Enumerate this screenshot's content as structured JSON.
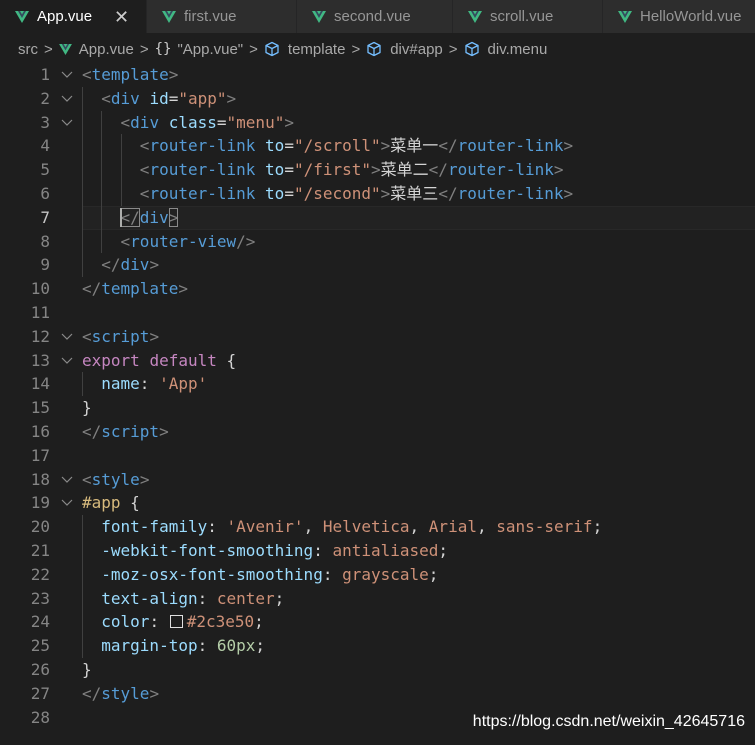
{
  "tabs": [
    {
      "label": "App.vue",
      "active": true,
      "close_glyph": "✕"
    },
    {
      "label": "first.vue",
      "active": false
    },
    {
      "label": "second.vue",
      "active": false
    },
    {
      "label": "scroll.vue",
      "active": false
    },
    {
      "label": "HelloWorld.vue",
      "active": false
    }
  ],
  "breadcrumb": {
    "items": [
      {
        "label": "src",
        "icon": null
      },
      {
        "label": "App.vue",
        "icon": "vue-icon"
      },
      {
        "label": "\"App.vue\"",
        "icon": "braces-icon"
      },
      {
        "label": "template",
        "icon": "cube-icon"
      },
      {
        "label": "div#app",
        "icon": "cube-icon"
      },
      {
        "label": "div.menu",
        "icon": "cube-icon"
      }
    ],
    "separator": ">",
    "braces_glyph": "{}"
  },
  "editor": {
    "current_line": 7,
    "lines": [
      {
        "n": "1",
        "tokens": [
          [
            "punc",
            "<"
          ],
          [
            "tag",
            "template"
          ],
          [
            "punc",
            ">"
          ]
        ]
      },
      {
        "n": "2",
        "tokens": [
          [
            "ws",
            "  "
          ],
          [
            "punc",
            "<"
          ],
          [
            "tag",
            "div"
          ],
          [
            "ws",
            " "
          ],
          [
            "attr",
            "id"
          ],
          [
            "plain",
            "="
          ],
          [
            "str",
            "\"app\""
          ],
          [
            "punc",
            ">"
          ]
        ]
      },
      {
        "n": "3",
        "tokens": [
          [
            "ws",
            "    "
          ],
          [
            "punc",
            "<"
          ],
          [
            "tag",
            "div"
          ],
          [
            "ws",
            " "
          ],
          [
            "attr",
            "class"
          ],
          [
            "plain",
            "="
          ],
          [
            "str",
            "\"menu\""
          ],
          [
            "punc",
            ">"
          ]
        ]
      },
      {
        "n": "4",
        "tokens": [
          [
            "ws",
            "      "
          ],
          [
            "punc",
            "<"
          ],
          [
            "tag",
            "router-link"
          ],
          [
            "ws",
            " "
          ],
          [
            "attr",
            "to"
          ],
          [
            "plain",
            "="
          ],
          [
            "str",
            "\"/scroll\""
          ],
          [
            "punc",
            ">"
          ],
          [
            "plain",
            "菜单一"
          ],
          [
            "punc",
            "</"
          ],
          [
            "tag",
            "router-link"
          ],
          [
            "punc",
            ">"
          ]
        ]
      },
      {
        "n": "5",
        "tokens": [
          [
            "ws",
            "      "
          ],
          [
            "punc",
            "<"
          ],
          [
            "tag",
            "router-link"
          ],
          [
            "ws",
            " "
          ],
          [
            "attr",
            "to"
          ],
          [
            "plain",
            "="
          ],
          [
            "str",
            "\"/first\""
          ],
          [
            "punc",
            ">"
          ],
          [
            "plain",
            "菜单二"
          ],
          [
            "punc",
            "</"
          ],
          [
            "tag",
            "router-link"
          ],
          [
            "punc",
            ">"
          ]
        ]
      },
      {
        "n": "6",
        "tokens": [
          [
            "ws",
            "      "
          ],
          [
            "punc",
            "<"
          ],
          [
            "tag",
            "router-link"
          ],
          [
            "ws",
            " "
          ],
          [
            "attr",
            "to"
          ],
          [
            "plain",
            "="
          ],
          [
            "str",
            "\"/second\""
          ],
          [
            "punc",
            ">"
          ],
          [
            "plain",
            "菜单三"
          ],
          [
            "punc",
            "</"
          ],
          [
            "tag",
            "router-link"
          ],
          [
            "punc",
            ">"
          ]
        ]
      },
      {
        "n": "7",
        "tokens": [
          [
            "ws",
            "    "
          ],
          [
            "box",
            "</"
          ],
          [
            "tag",
            "div"
          ],
          [
            "box",
            ">"
          ]
        ]
      },
      {
        "n": "8",
        "tokens": [
          [
            "ws",
            "    "
          ],
          [
            "punc",
            "<"
          ],
          [
            "tag",
            "router-view"
          ],
          [
            "punc",
            "/>"
          ]
        ]
      },
      {
        "n": "9",
        "tokens": [
          [
            "ws",
            "  "
          ],
          [
            "punc",
            "</"
          ],
          [
            "tag",
            "div"
          ],
          [
            "punc",
            ">"
          ]
        ]
      },
      {
        "n": "10",
        "tokens": [
          [
            "punc",
            "</"
          ],
          [
            "tag",
            "template"
          ],
          [
            "punc",
            ">"
          ]
        ]
      },
      {
        "n": "11",
        "tokens": []
      },
      {
        "n": "12",
        "tokens": [
          [
            "punc",
            "<"
          ],
          [
            "tag",
            "script"
          ],
          [
            "punc",
            ">"
          ]
        ]
      },
      {
        "n": "13",
        "tokens": [
          [
            "kw",
            "export"
          ],
          [
            "ws",
            " "
          ],
          [
            "kw",
            "default"
          ],
          [
            "ws",
            " "
          ],
          [
            "plain",
            "{"
          ]
        ]
      },
      {
        "n": "14",
        "tokens": [
          [
            "ws",
            "  "
          ],
          [
            "attr",
            "name"
          ],
          [
            "plain",
            ": "
          ],
          [
            "str",
            "'App'"
          ]
        ]
      },
      {
        "n": "15",
        "tokens": [
          [
            "plain",
            "}"
          ]
        ]
      },
      {
        "n": "16",
        "tokens": [
          [
            "punc",
            "</"
          ],
          [
            "tag",
            "script"
          ],
          [
            "punc",
            ">"
          ]
        ]
      },
      {
        "n": "17",
        "tokens": []
      },
      {
        "n": "18",
        "tokens": [
          [
            "punc",
            "<"
          ],
          [
            "tag",
            "style"
          ],
          [
            "punc",
            ">"
          ]
        ]
      },
      {
        "n": "19",
        "tokens": [
          [
            "sel",
            "#app"
          ],
          [
            "ws",
            " "
          ],
          [
            "plain",
            "{"
          ]
        ]
      },
      {
        "n": "20",
        "tokens": [
          [
            "ws",
            "  "
          ],
          [
            "attr",
            "font-family"
          ],
          [
            "plain",
            ": "
          ],
          [
            "str",
            "'Avenir'"
          ],
          [
            "plain",
            ", "
          ],
          [
            "str",
            "Helvetica"
          ],
          [
            "plain",
            ", "
          ],
          [
            "str",
            "Arial"
          ],
          [
            "plain",
            ", "
          ],
          [
            "str",
            "sans-serif"
          ],
          [
            "plain",
            ";"
          ]
        ]
      },
      {
        "n": "21",
        "tokens": [
          [
            "ws",
            "  "
          ],
          [
            "attr",
            "-webkit-font-smoothing"
          ],
          [
            "plain",
            ": "
          ],
          [
            "str",
            "antialiased"
          ],
          [
            "plain",
            ";"
          ]
        ]
      },
      {
        "n": "22",
        "tokens": [
          [
            "ws",
            "  "
          ],
          [
            "attr",
            "-moz-osx-font-smoothing"
          ],
          [
            "plain",
            ": "
          ],
          [
            "str",
            "grayscale"
          ],
          [
            "plain",
            ";"
          ]
        ]
      },
      {
        "n": "23",
        "tokens": [
          [
            "ws",
            "  "
          ],
          [
            "attr",
            "text-align"
          ],
          [
            "plain",
            ": "
          ],
          [
            "str",
            "center"
          ],
          [
            "plain",
            ";"
          ]
        ]
      },
      {
        "n": "24",
        "tokens": [
          [
            "ws",
            "  "
          ],
          [
            "attr",
            "color"
          ],
          [
            "plain",
            ": "
          ],
          [
            "swatch",
            ""
          ],
          [
            "str",
            "#2c3e50"
          ],
          [
            "plain",
            ";"
          ]
        ]
      },
      {
        "n": "25",
        "tokens": [
          [
            "ws",
            "  "
          ],
          [
            "attr",
            "margin-top"
          ],
          [
            "plain",
            ": "
          ],
          [
            "num",
            "60px"
          ],
          [
            "plain",
            ";"
          ]
        ]
      },
      {
        "n": "26",
        "tokens": [
          [
            "plain",
            "}"
          ]
        ]
      },
      {
        "n": "27",
        "tokens": [
          [
            "punc",
            "</"
          ],
          [
            "tag",
            "style"
          ],
          [
            "punc",
            ">"
          ]
        ]
      },
      {
        "n": "28",
        "tokens": []
      }
    ],
    "fold_lines": [
      1,
      2,
      3,
      12,
      13,
      18,
      19
    ]
  },
  "watermark": "https://blog.csdn.net/weixin_42645716",
  "colors": {
    "background": "#1e1e1e",
    "tab_inactive": "#2d2d2d",
    "vue_green": "#41b883",
    "tag": "#569cd6",
    "attribute": "#9cdcfe",
    "string": "#ce9178",
    "keyword": "#c586c0",
    "selector": "#d7ba7d",
    "number": "#b5cea8",
    "punctuation": "#808080",
    "cube_icon": "#75beff"
  }
}
